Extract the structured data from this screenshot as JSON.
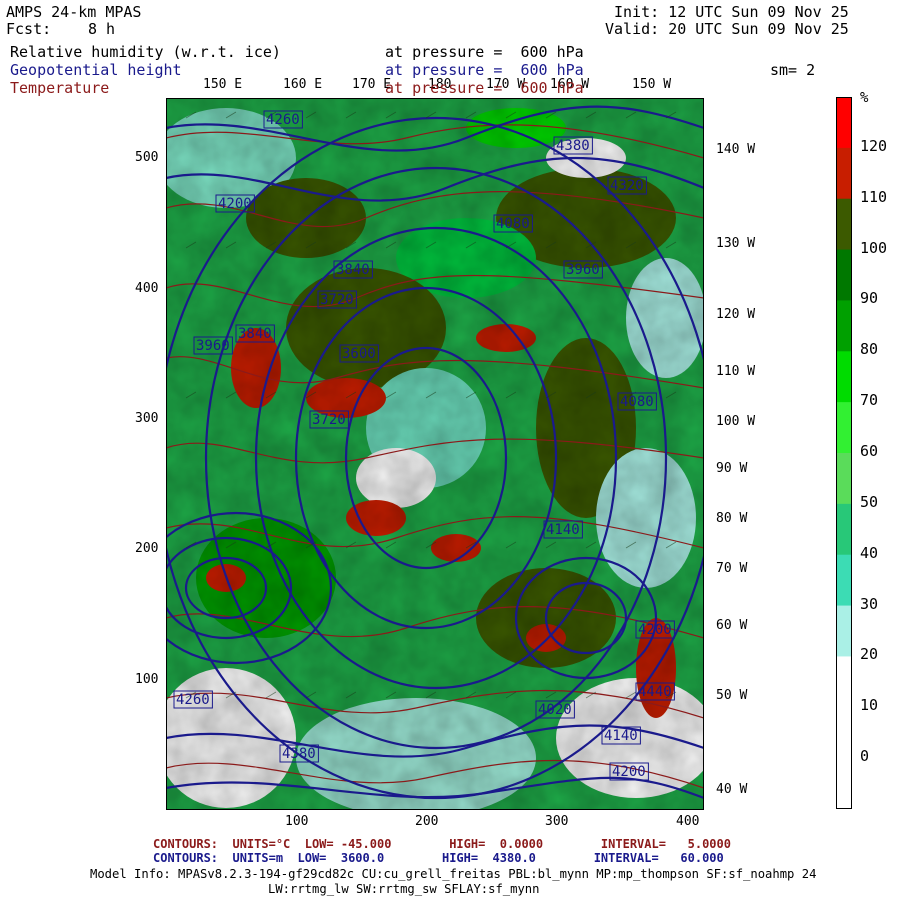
{
  "header": {
    "model": "AMPS 24-km MPAS",
    "fcst_label": "Fcst:",
    "fcst_value": "8 h",
    "init": "Init: 12 UTC Sun 09 Nov 25",
    "valid": "Valid: 20 UTC Sun 09 Nov 25",
    "smoothing": "sm= 2"
  },
  "fields": [
    {
      "name": "Relative humidity (w.r.t. ice)",
      "level": "at pressure =  600 hPa",
      "color": "#000000"
    },
    {
      "name": "Geopotential height",
      "level": "at pressure =  600 hPa",
      "color": "#1a1a8c"
    },
    {
      "name": "Temperature",
      "level": "at pressure =  600 hPa",
      "color": "#8b1a1a"
    }
  ],
  "top_longitudes": [
    "150 E",
    "160 E",
    "170 E",
    "180",
    "170 W",
    "160 W",
    "150 W"
  ],
  "right_longitudes": [
    "140 W",
    "130 W",
    "120 W",
    "110 W",
    "100 W",
    "90 W",
    "80 W",
    "70 W",
    "60 W",
    "50 W",
    "40 W"
  ],
  "y_ticks": [
    "500",
    "400",
    "300",
    "200",
    "100"
  ],
  "x_ticks": [
    "100",
    "200",
    "300",
    "400"
  ],
  "colorbar": {
    "unit": "%",
    "labels": [
      "120",
      "110",
      "100",
      "90",
      "80",
      "70",
      "60",
      "50",
      "40",
      "30",
      "20",
      "10",
      "0"
    ],
    "colors": [
      "#ff0000",
      "#c81e00",
      "#3c5a00",
      "#007800",
      "#00a000",
      "#00dc00",
      "#32f032",
      "#5adc5a",
      "#28c878",
      "#3cdcb4",
      "#aaf0e6",
      "#ffffff",
      "#ffffff",
      "#ffffff"
    ]
  },
  "height_contour_labels": [
    "4260",
    "4380",
    "4320",
    "4200",
    "4080",
    "3960",
    "3840",
    "3720",
    "3600",
    "3840",
    "3720",
    "3960",
    "4080",
    "4140",
    "4380",
    "4260",
    "4200",
    "4020",
    "4140",
    "4440",
    "4200"
  ],
  "footer": {
    "temp_contours": "CONTOURS:  UNITS=°C  LOW= -45.000        HIGH=  0.0000        INTERVAL=   5.0000",
    "height_contours": "CONTOURS:  UNITS=m  LOW=  3600.0        HIGH=  4380.0        INTERVAL=   60.000",
    "model_info_1": "Model Info: MPASv8.2.3-194-gf29cd82c CU:cu_grell_freitas PBL:bl_mynn MP:mp_thompson SF:sf_noahmp 24",
    "model_info_2": "LW:rrtmg_lw SW:rrtmg_sw SFLAY:sf_mynn"
  }
}
